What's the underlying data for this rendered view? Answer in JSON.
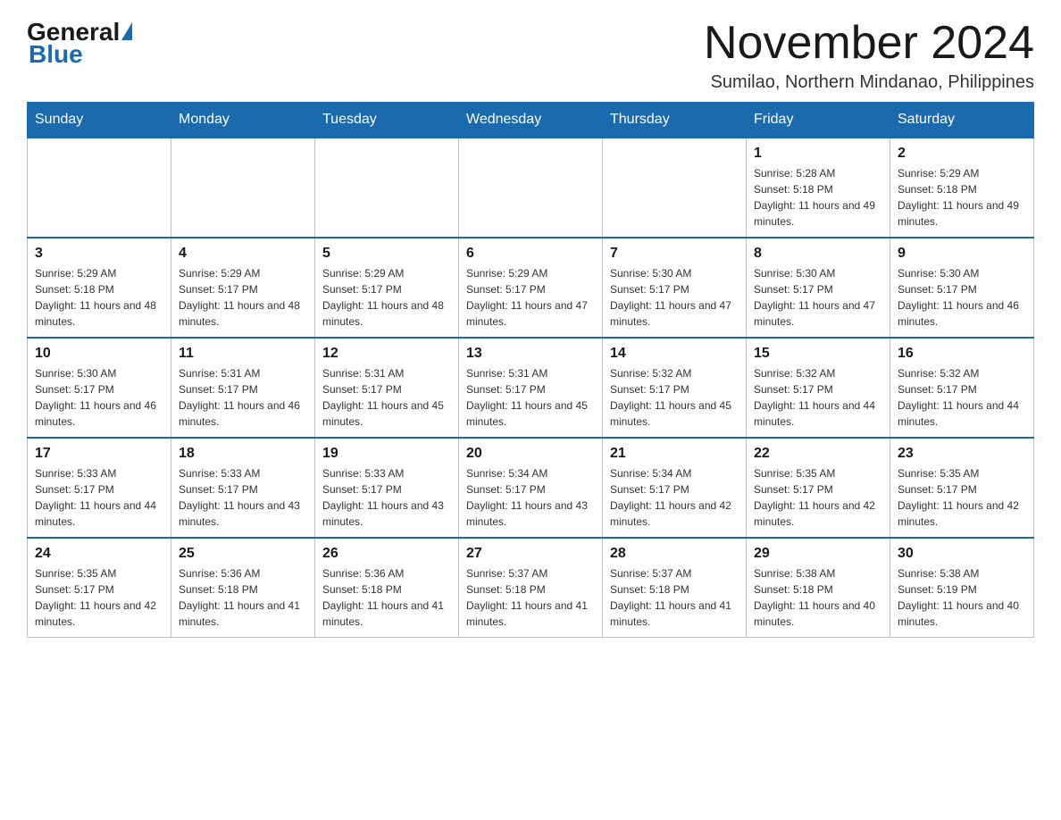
{
  "logo": {
    "general": "General",
    "blue": "Blue",
    "triangle": "▲"
  },
  "header": {
    "month_title": "November 2024",
    "subtitle": "Sumilao, Northern Mindanao, Philippines"
  },
  "days_of_week": [
    "Sunday",
    "Monday",
    "Tuesday",
    "Wednesday",
    "Thursday",
    "Friday",
    "Saturday"
  ],
  "weeks": [
    [
      {
        "day": "",
        "info": ""
      },
      {
        "day": "",
        "info": ""
      },
      {
        "day": "",
        "info": ""
      },
      {
        "day": "",
        "info": ""
      },
      {
        "day": "",
        "info": ""
      },
      {
        "day": "1",
        "info": "Sunrise: 5:28 AM\nSunset: 5:18 PM\nDaylight: 11 hours and 49 minutes."
      },
      {
        "day": "2",
        "info": "Sunrise: 5:29 AM\nSunset: 5:18 PM\nDaylight: 11 hours and 49 minutes."
      }
    ],
    [
      {
        "day": "3",
        "info": "Sunrise: 5:29 AM\nSunset: 5:18 PM\nDaylight: 11 hours and 48 minutes."
      },
      {
        "day": "4",
        "info": "Sunrise: 5:29 AM\nSunset: 5:17 PM\nDaylight: 11 hours and 48 minutes."
      },
      {
        "day": "5",
        "info": "Sunrise: 5:29 AM\nSunset: 5:17 PM\nDaylight: 11 hours and 48 minutes."
      },
      {
        "day": "6",
        "info": "Sunrise: 5:29 AM\nSunset: 5:17 PM\nDaylight: 11 hours and 47 minutes."
      },
      {
        "day": "7",
        "info": "Sunrise: 5:30 AM\nSunset: 5:17 PM\nDaylight: 11 hours and 47 minutes."
      },
      {
        "day": "8",
        "info": "Sunrise: 5:30 AM\nSunset: 5:17 PM\nDaylight: 11 hours and 47 minutes."
      },
      {
        "day": "9",
        "info": "Sunrise: 5:30 AM\nSunset: 5:17 PM\nDaylight: 11 hours and 46 minutes."
      }
    ],
    [
      {
        "day": "10",
        "info": "Sunrise: 5:30 AM\nSunset: 5:17 PM\nDaylight: 11 hours and 46 minutes."
      },
      {
        "day": "11",
        "info": "Sunrise: 5:31 AM\nSunset: 5:17 PM\nDaylight: 11 hours and 46 minutes."
      },
      {
        "day": "12",
        "info": "Sunrise: 5:31 AM\nSunset: 5:17 PM\nDaylight: 11 hours and 45 minutes."
      },
      {
        "day": "13",
        "info": "Sunrise: 5:31 AM\nSunset: 5:17 PM\nDaylight: 11 hours and 45 minutes."
      },
      {
        "day": "14",
        "info": "Sunrise: 5:32 AM\nSunset: 5:17 PM\nDaylight: 11 hours and 45 minutes."
      },
      {
        "day": "15",
        "info": "Sunrise: 5:32 AM\nSunset: 5:17 PM\nDaylight: 11 hours and 44 minutes."
      },
      {
        "day": "16",
        "info": "Sunrise: 5:32 AM\nSunset: 5:17 PM\nDaylight: 11 hours and 44 minutes."
      }
    ],
    [
      {
        "day": "17",
        "info": "Sunrise: 5:33 AM\nSunset: 5:17 PM\nDaylight: 11 hours and 44 minutes."
      },
      {
        "day": "18",
        "info": "Sunrise: 5:33 AM\nSunset: 5:17 PM\nDaylight: 11 hours and 43 minutes."
      },
      {
        "day": "19",
        "info": "Sunrise: 5:33 AM\nSunset: 5:17 PM\nDaylight: 11 hours and 43 minutes."
      },
      {
        "day": "20",
        "info": "Sunrise: 5:34 AM\nSunset: 5:17 PM\nDaylight: 11 hours and 43 minutes."
      },
      {
        "day": "21",
        "info": "Sunrise: 5:34 AM\nSunset: 5:17 PM\nDaylight: 11 hours and 42 minutes."
      },
      {
        "day": "22",
        "info": "Sunrise: 5:35 AM\nSunset: 5:17 PM\nDaylight: 11 hours and 42 minutes."
      },
      {
        "day": "23",
        "info": "Sunrise: 5:35 AM\nSunset: 5:17 PM\nDaylight: 11 hours and 42 minutes."
      }
    ],
    [
      {
        "day": "24",
        "info": "Sunrise: 5:35 AM\nSunset: 5:17 PM\nDaylight: 11 hours and 42 minutes."
      },
      {
        "day": "25",
        "info": "Sunrise: 5:36 AM\nSunset: 5:18 PM\nDaylight: 11 hours and 41 minutes."
      },
      {
        "day": "26",
        "info": "Sunrise: 5:36 AM\nSunset: 5:18 PM\nDaylight: 11 hours and 41 minutes."
      },
      {
        "day": "27",
        "info": "Sunrise: 5:37 AM\nSunset: 5:18 PM\nDaylight: 11 hours and 41 minutes."
      },
      {
        "day": "28",
        "info": "Sunrise: 5:37 AM\nSunset: 5:18 PM\nDaylight: 11 hours and 41 minutes."
      },
      {
        "day": "29",
        "info": "Sunrise: 5:38 AM\nSunset: 5:18 PM\nDaylight: 11 hours and 40 minutes."
      },
      {
        "day": "30",
        "info": "Sunrise: 5:38 AM\nSunset: 5:19 PM\nDaylight: 11 hours and 40 minutes."
      }
    ]
  ]
}
